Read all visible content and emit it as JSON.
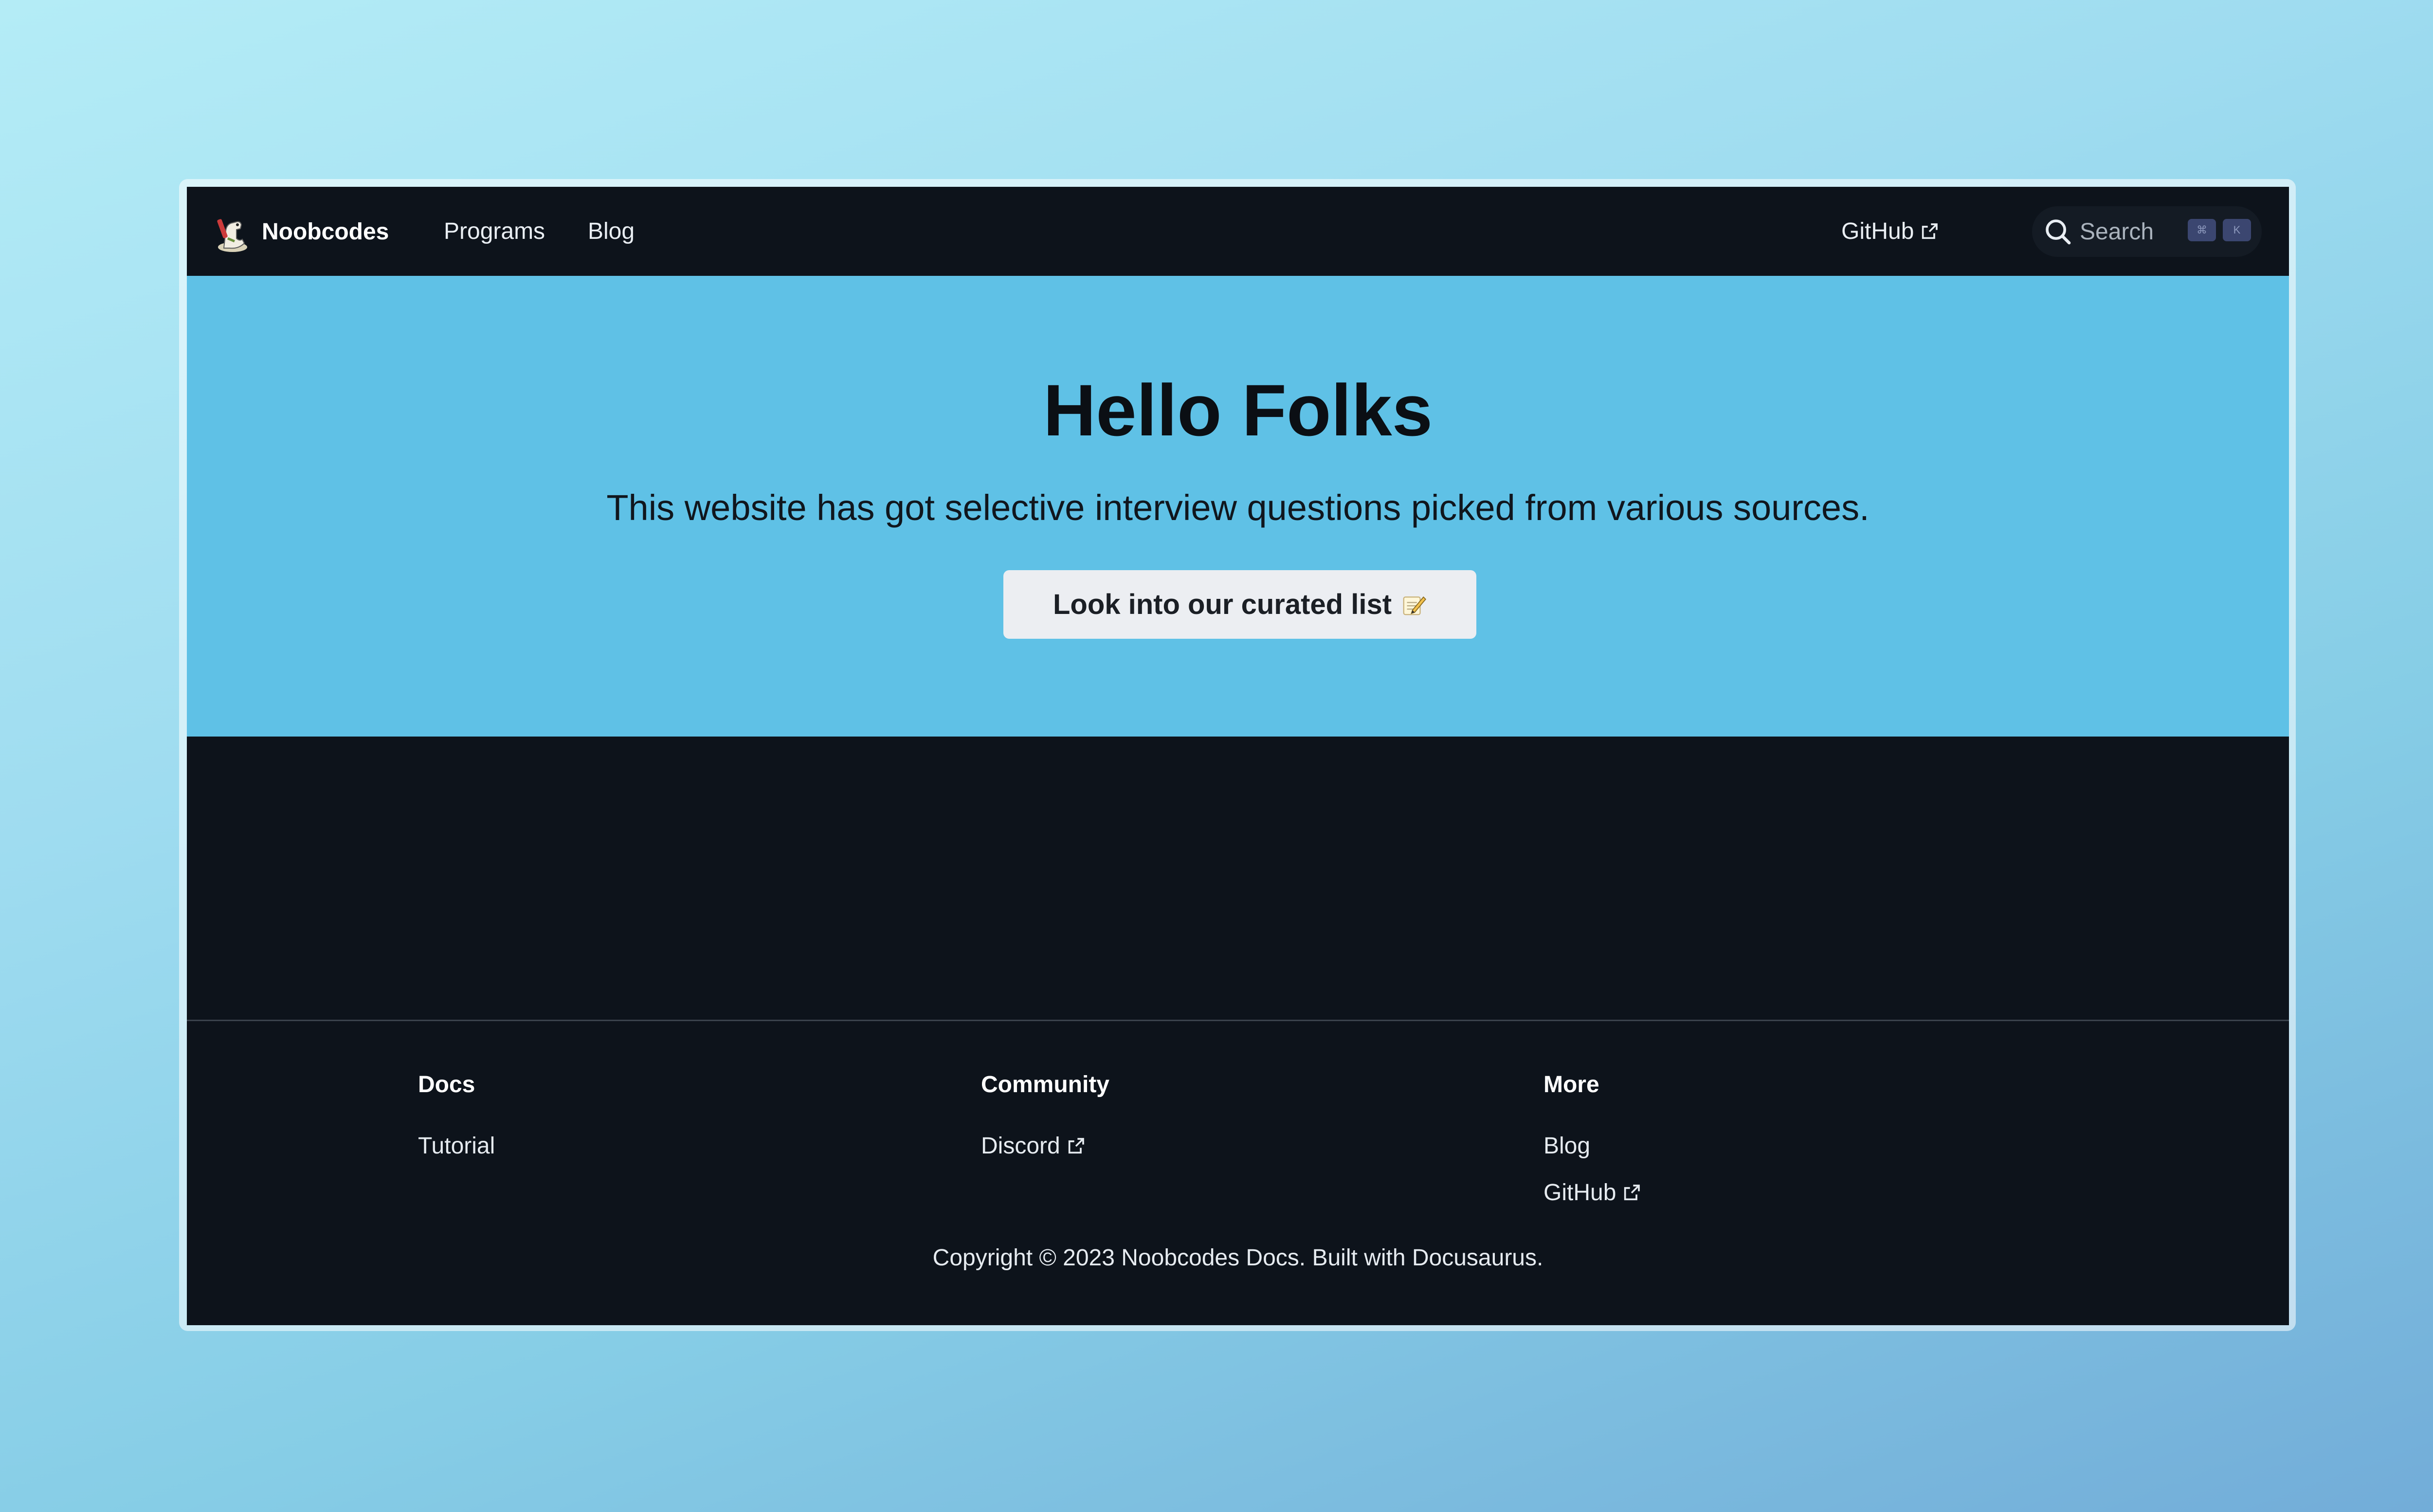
{
  "navbar": {
    "brand_name": "Noobcodes",
    "links": [
      {
        "label": "Programs"
      },
      {
        "label": "Blog"
      }
    ],
    "github_label": "GitHub",
    "search": {
      "placeholder": "Search",
      "shortcut_keys": [
        "⌘",
        "K"
      ]
    }
  },
  "hero": {
    "title": "Hello Folks",
    "subtitle": "This website has got selective interview questions picked from various sources.",
    "button_label": "Look into our curated list",
    "background_color": "#5fc1e6"
  },
  "footer": {
    "columns": [
      {
        "heading": "Docs",
        "links": [
          {
            "label": "Tutorial",
            "external": false
          }
        ]
      },
      {
        "heading": "Community",
        "links": [
          {
            "label": "Discord",
            "external": true
          }
        ]
      },
      {
        "heading": "More",
        "links": [
          {
            "label": "Blog",
            "external": false
          },
          {
            "label": "GitHub",
            "external": true
          }
        ]
      }
    ],
    "copyright": "Copyright © 2023 Noobcodes Docs. Built with Docusaurus."
  },
  "colors": {
    "page_background": "#0d131b",
    "accent": "#5fc1e6"
  },
  "icons": {
    "logo": "dinosaur-logo-icon",
    "external_link": "external-link-icon",
    "theme_toggle": "moon-icon",
    "search": "search-icon",
    "button_emoji": "memo-icon"
  }
}
